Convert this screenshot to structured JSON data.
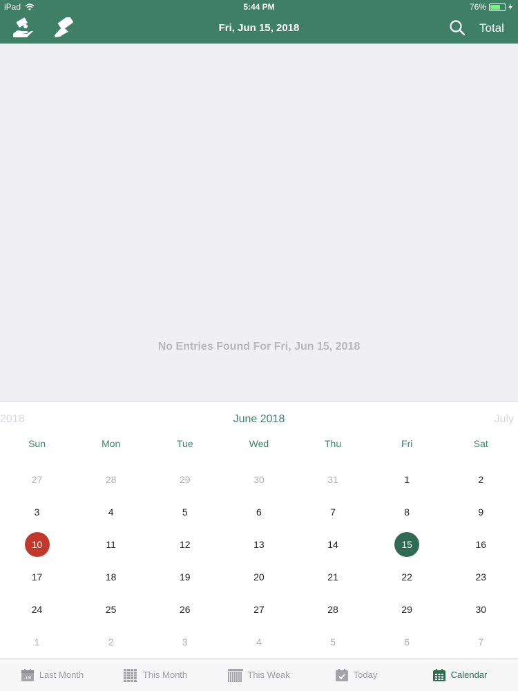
{
  "status_bar": {
    "carrier": "iPad",
    "time": "5:44 PM",
    "battery_percent": "76%",
    "battery_level": 0.76
  },
  "nav": {
    "title": "Fri, Jun 15, 2018",
    "total_label": "Total",
    "icons": [
      "hand-money-icon",
      "cash-icon",
      "search-icon"
    ]
  },
  "main": {
    "empty_message": "No Entries Found For Fri, Jun 15, 2018"
  },
  "calendar": {
    "prev_label": "2018",
    "month_label": "June 2018",
    "next_label": "July",
    "weekdays": [
      "Sun",
      "Mon",
      "Tue",
      "Wed",
      "Thu",
      "Fri",
      "Sat"
    ],
    "weeks": [
      [
        "27",
        "28",
        "29",
        "30",
        "31",
        "1",
        "2"
      ],
      [
        "3",
        "4",
        "5",
        "6",
        "7",
        "8",
        "9"
      ],
      [
        "10",
        "11",
        "12",
        "13",
        "14",
        "15",
        "16"
      ],
      [
        "17",
        "18",
        "19",
        "20",
        "21",
        "22",
        "23"
      ],
      [
        "24",
        "25",
        "26",
        "27",
        "28",
        "29",
        "30"
      ],
      [
        "1",
        "2",
        "3",
        "4",
        "5",
        "6",
        "7"
      ]
    ],
    "selected_day": "15",
    "marked_day": "10"
  },
  "tabbar": {
    "tabs": [
      {
        "label": "Last Month",
        "icon": "calendar-minus-icon"
      },
      {
        "label": "This Month",
        "icon": "calendar-grid-icon"
      },
      {
        "label": "This Weak",
        "icon": "calendar-week-icon"
      },
      {
        "label": "Today",
        "icon": "calendar-check-icon"
      },
      {
        "label": "Calendar",
        "icon": "calendar-icon"
      }
    ],
    "active_index": 4
  },
  "colors": {
    "accent": "#3f7f66",
    "selected": "#2f6b53",
    "marked": "#c0392b",
    "muted_text": "#b0b0b5"
  }
}
